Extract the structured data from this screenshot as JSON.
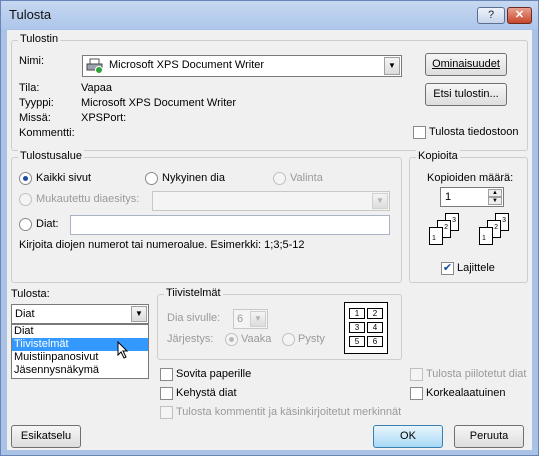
{
  "window": {
    "title": "Tulosta",
    "help_label": "?",
    "close_label": "✕"
  },
  "printer": {
    "group_title": "Tulostin",
    "name_label": "Nimi:",
    "name_value": "Microsoft XPS Document Writer",
    "status_label": "Tila:",
    "status_value": "Vapaa",
    "type_label": "Tyyppi:",
    "type_value": "Microsoft XPS Document Writer",
    "where_label": "Missä:",
    "where_value": "XPSPort:",
    "comment_label": "Kommentti:",
    "properties_button": "Ominaisuudet",
    "find_button": "Etsi tulostin...",
    "print_to_file_label": "Tulosta tiedostoon",
    "print_to_file_checked": false
  },
  "range": {
    "group_title": "Tulostusalue",
    "all_label": "Kaikki sivut",
    "current_label": "Nykyinen dia",
    "selection_label": "Valinta",
    "custom_label": "Mukautettu diaesitys:",
    "slides_label": "Diat:",
    "slides_value": "",
    "hint": "Kirjoita diojen numerot tai numeroalue. Esimerkki: 1;3;5-12",
    "selected": "Kaikki sivut"
  },
  "copies": {
    "group_title": "Kopioita",
    "count_label": "Kopioiden määrä:",
    "count_value": "1",
    "collate_label": "Lajittele",
    "collate_checked": true,
    "page_numbers": [
      "1",
      "2",
      "3"
    ]
  },
  "print_what": {
    "label": "Tulosta:",
    "value": "Diat",
    "options": [
      "Diat",
      "Tiivistelmät",
      "Muistiinpanosivut",
      "Jäsennysnäkymä"
    ],
    "highlighted": "Tiivistelmät"
  },
  "handouts": {
    "group_title": "Tiivistelmät",
    "per_page_label": "Dia sivulle:",
    "per_page_value": "6",
    "order_label": "Järjestys:",
    "horizontal_label": "Vaaka",
    "vertical_label": "Pysty",
    "order_selected": "Vaaka",
    "preview_numbers": [
      "1",
      "2",
      "3",
      "4",
      "5",
      "6"
    ]
  },
  "options": {
    "fit_label": "Sovita paperille",
    "frame_label": "Kehystä diat",
    "comments_label": "Tulosta kommentit ja käsinkirjoitetut merkinnät",
    "hidden_label": "Tulosta piilotetut diat",
    "hq_label": "Korkealaatuinen"
  },
  "footer": {
    "preview_button": "Esikatselu",
    "ok_button": "OK",
    "cancel_button": "Peruuta"
  },
  "colors": {
    "accent": "#3399ff",
    "titlebar": "#adc6ea"
  }
}
